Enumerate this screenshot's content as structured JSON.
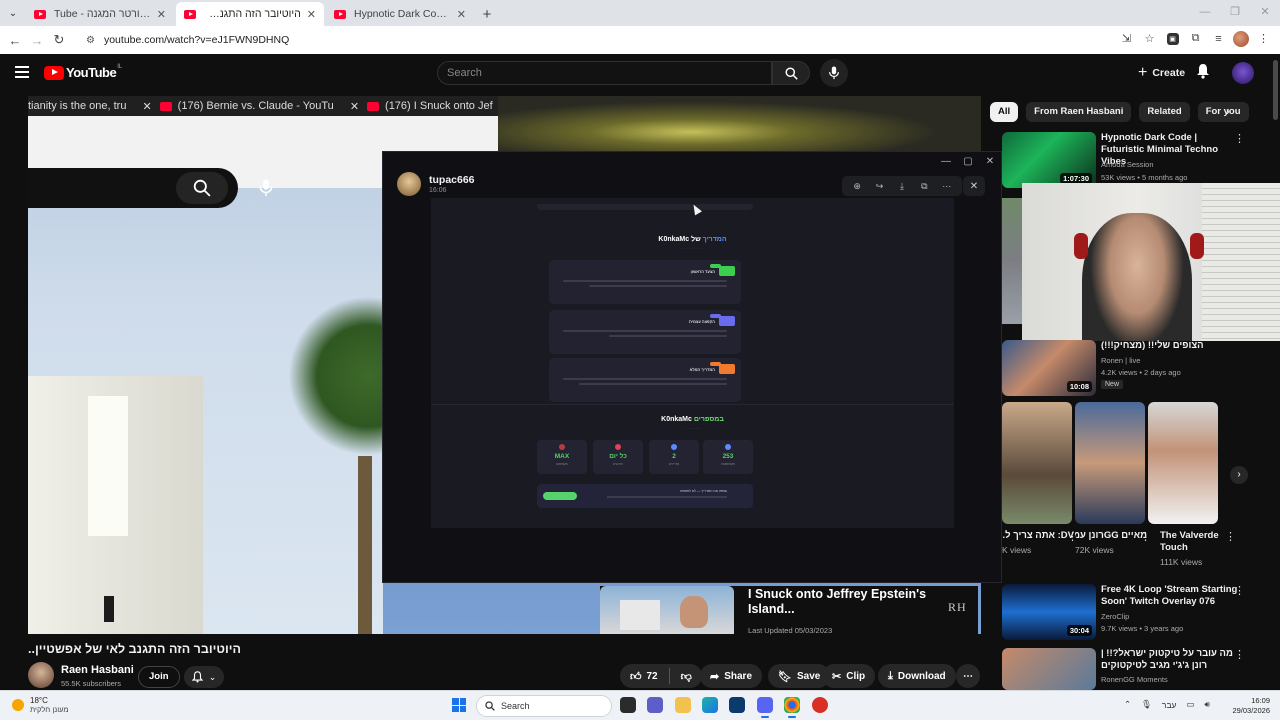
{
  "browser": {
    "tabs": [
      {
        "label": "Tube - וה ההסכורטר המגנה",
        "active": false
      },
      {
        "label": "היוטיובר הזה התגנב לאי של אפ...",
        "active": true
      },
      {
        "label": "Hypnotic Dark Code | Futuristic",
        "active": false
      }
    ],
    "url": "youtube.com/watch?v=eJ1FWN9DHNQ"
  },
  "masthead": {
    "logo_text": "YouTube",
    "country_code": "IL",
    "search_placeholder": "Search",
    "create_label": "Create"
  },
  "player_bg": {
    "tabs": [
      {
        "label": "tianity is the one, tru"
      },
      {
        "label": "(176) Bernie vs. Claude - YouTu"
      },
      {
        "label": "(176) I Snuck onto Jef"
      }
    ]
  },
  "viewer": {
    "username": "tupac666",
    "time": "16:06",
    "image": {
      "heading1_prefix": "K0nkaMc",
      "heading1_accent": "המדריך",
      "heading1_suffix": "של",
      "items": [
        {
          "label": "הצעד הראשון",
          "color": "#3ccf4e"
        },
        {
          "label": "הקפצה עצמית",
          "color": "#6a6cf0"
        },
        {
          "label": "המדריך המלא",
          "color": "#f07a2e"
        }
      ],
      "heading2_prefix": "K0nkaMc",
      "heading2_accent": "במספרים",
      "stats": [
        {
          "value": "MAX",
          "caption": "מקסימום",
          "color": "#56d36a",
          "dot": "#b04040"
        },
        {
          "value": "כל יום",
          "caption": "עדכונים",
          "color": "#56d36a",
          "dot": "#e0415a"
        },
        {
          "value": "2",
          "caption": "מדריכים",
          "color": "#56d36a",
          "dot": "#5b8cff"
        },
        {
          "value": "253",
          "caption": "משתמשים",
          "color": "#56d36a",
          "dot": "#5b8cff"
        }
      ],
      "banner_text": "שתפו את המדריך — לא לפספס"
    }
  },
  "video": {
    "title": "היוטיובר הזה התגנב לאי של אפשטיין..",
    "channel_name": "Raen Hasbani",
    "subscribers": "55.5K subscribers",
    "join_label": "Join",
    "likes": "72",
    "share_label": "Share",
    "save_label": "Save",
    "clip_label": "Clip",
    "download_label": "Download"
  },
  "end_card": {
    "title": "I Snuck onto Jeffrey Epstein's Island...",
    "subtitle": "Last Updated 05/03/2023",
    "logo": "RH"
  },
  "chips": [
    "All",
    "From Raen Hasbani",
    "Related",
    "For you"
  ],
  "recommendations": [
    {
      "title": "Hypnotic Dark Code | Futuristic Minimal Techno Vibes",
      "channel": "Amoda Session",
      "meta": "53K views • 5 months ago",
      "duration": "1:07:30"
    },
    {
      "title": "הצופים שלי!! (מצחיק!!!)",
      "channel": "Ronen | live",
      "meta": "4.2K views • 2 days ago",
      "duration": "10:08",
      "badge": "New"
    },
    {
      "title": "Free 4K Loop 'Stream Starting Soon' Twitch Overlay 076",
      "channel": "ZeroClip",
      "meta": "9.7K views • 3 years ago",
      "duration": "30:04"
    },
    {
      "title": "מה עובר על טיקטוק ישראל?!! | רונן ג'ג'י מגיב לטיקטוקים",
      "channel": "RonenGG Moments",
      "meta": "",
      "duration": ""
    }
  ],
  "shorts": [
    {
      "title": "DV: אתה צריך ל...",
      "views": "K views"
    },
    {
      "title": "מאיים GGרונן עמרם דניאל ...",
      "views": "72K views"
    },
    {
      "title": "The Valverde Touch",
      "views": "111K views"
    }
  ],
  "taskbar": {
    "temp": "18°C",
    "condition": "מעונן חלקית",
    "search_label": "Search",
    "lang": "עבר",
    "time": "16:09",
    "date": "29/03/2026"
  }
}
